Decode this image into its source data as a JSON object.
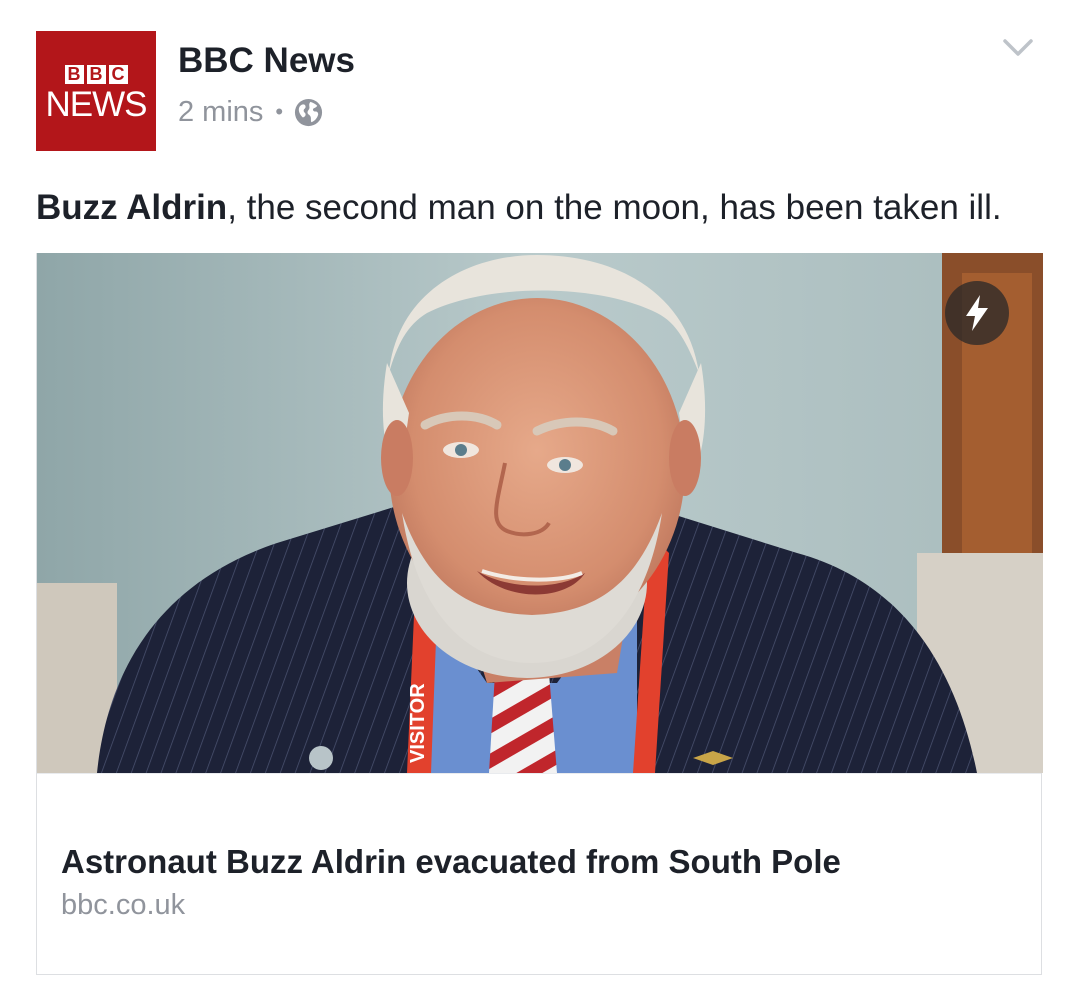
{
  "post": {
    "page_name": "BBC News",
    "timestamp": "2 mins",
    "separator": "•",
    "privacy_icon": "globe-icon",
    "menu_icon": "chevron-down-icon",
    "logo": {
      "blocks": [
        "B",
        "B",
        "C"
      ],
      "word": "NEWS",
      "color": "#b3161a"
    },
    "message": {
      "bold": "Buzz Aldrin",
      "rest": ", the second man on the moon, has been taken ill."
    }
  },
  "link_card": {
    "image_alt_icon": "instant-article-lightning-icon",
    "lanyard_text": "VISITOR",
    "title": "Astronaut Buzz Aldrin evacuated from South Pole",
    "domain": "bbc.co.uk"
  },
  "colors": {
    "text_primary": "#1d2129",
    "text_secondary": "#90949c",
    "brand_red": "#b3161a"
  }
}
